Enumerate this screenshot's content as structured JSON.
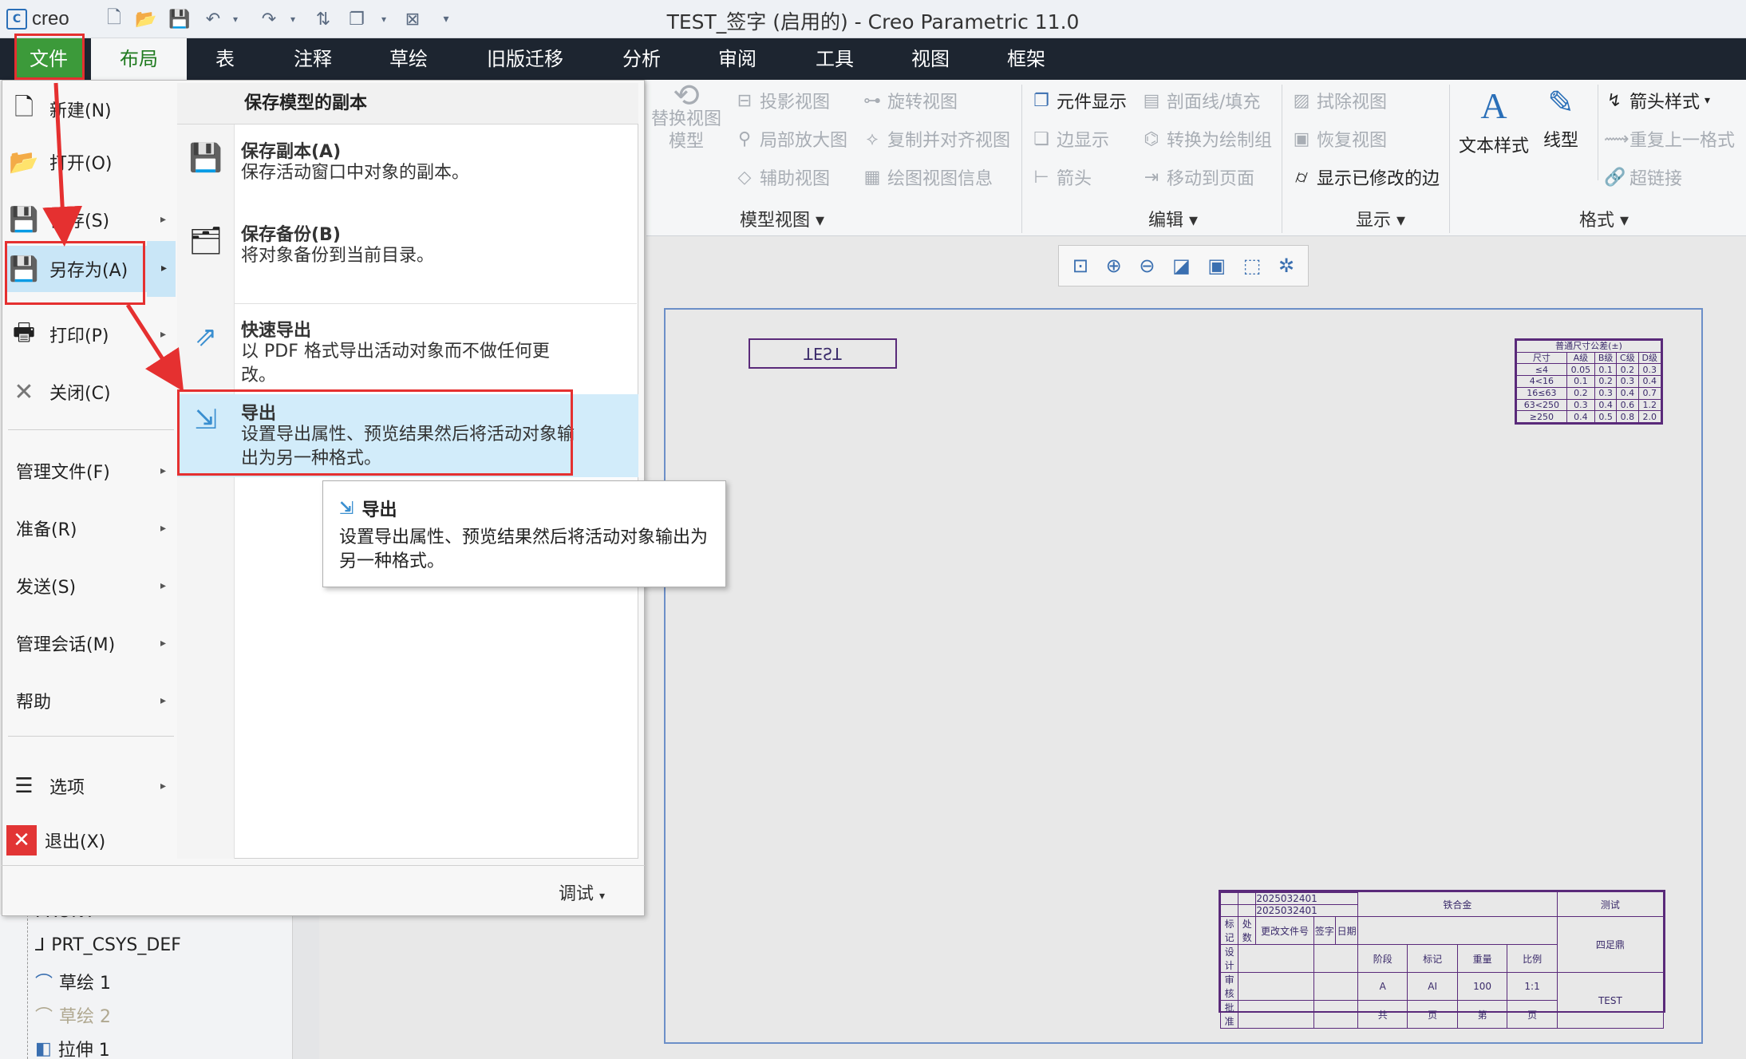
{
  "window": {
    "title": "TEST_签字 (启用的) - Creo Parametric 11.0",
    "logo": "creo"
  },
  "tabs": [
    {
      "label": "文件"
    },
    {
      "label": "布局"
    },
    {
      "label": "表"
    },
    {
      "label": "注释"
    },
    {
      "label": "草绘"
    },
    {
      "label": "旧版迁移"
    },
    {
      "label": "分析"
    },
    {
      "label": "审阅"
    },
    {
      "label": "工具"
    },
    {
      "label": "视图"
    },
    {
      "label": "框架"
    }
  ],
  "ribbon": {
    "model_views": {
      "replace": "替换视图\n模型",
      "projection": "投影视图",
      "detail": "局部放大图",
      "auxiliary": "辅助视图",
      "revolve": "旋转视图",
      "copy_align": "复制并对齐视图",
      "view_info": "绘图视图信息",
      "label": "模型视图"
    },
    "edit": {
      "component_display": "元件显示",
      "hatch": "剖面线/填充",
      "edge_display": "边显示",
      "convert_group": "转换为绘制组",
      "arrow": "箭头",
      "move_page": "移动到页面",
      "label": "编辑"
    },
    "display": {
      "erase": "拭除视图",
      "restore": "恢复视图",
      "show_modified": "显示已修改的边",
      "label": "显示"
    },
    "format": {
      "text_style": "文本样式",
      "line_style": "线型",
      "arrow_style": "箭头样式",
      "repeat": "重复上一格式",
      "hyperlink": "超链接",
      "label": "格式"
    }
  },
  "file_menu": {
    "items": [
      {
        "label": "新建(N)"
      },
      {
        "label": "打开(O)"
      },
      {
        "label": "保存(S)"
      },
      {
        "label": "另存为(A)"
      },
      {
        "label": "打印(P)"
      },
      {
        "label": "关闭(C)"
      }
    ],
    "subitems": [
      {
        "label": "管理文件(F)"
      },
      {
        "label": "准备(R)"
      },
      {
        "label": "发送(S)"
      },
      {
        "label": "管理会话(M)"
      },
      {
        "label": "帮助"
      }
    ],
    "bottom": [
      {
        "label": "选项"
      },
      {
        "label": "退出(X)"
      }
    ],
    "debug": "调试"
  },
  "save_as_panel": {
    "header": "保存模型的副本",
    "items": [
      {
        "title": "保存副本(A)",
        "desc": "保存活动窗口中对象的副本。"
      },
      {
        "title": "保存备份(B)",
        "desc": "将对象备份到当前目录。"
      },
      {
        "title": "快速导出",
        "desc": "以 PDF 格式导出活动对象而不做任何更改。"
      },
      {
        "title": "导出",
        "desc": "设置导出属性、预览结果然后将活动对象输出为另一种格式。"
      }
    ]
  },
  "tooltip": {
    "title": "导出",
    "desc": "设置导出属性、预览结果然后将活动对象输出为另一种格式。"
  },
  "tree": [
    {
      "label": "FRONT"
    },
    {
      "label": "PRT_CSYS_DEF"
    },
    {
      "label": "草绘 1"
    },
    {
      "label": "草绘 2"
    },
    {
      "label": "拉伸 1"
    }
  ],
  "drawing": {
    "test_label": "TEST",
    "tol_table": {
      "title": "普通尺寸公差(±)",
      "header": [
        "尺寸",
        "A级",
        "B级",
        "C级",
        "D级"
      ],
      "rows": [
        [
          "≤4",
          "0.05",
          "0.1",
          "0.2",
          "0.3"
        ],
        [
          "4<16",
          "0.1",
          "0.2",
          "0.3",
          "0.4"
        ],
        [
          "16≤63",
          "0.2",
          "0.3",
          "0.4",
          "0.7"
        ],
        [
          "63<250",
          "0.3",
          "0.4",
          "0.6",
          "1.2"
        ],
        [
          "≥250",
          "0.4",
          "0.5",
          "0.8",
          "2.0"
        ]
      ]
    },
    "title_block": {
      "date1": "2025032401",
      "date2": "2025032401",
      "material": "铁合金",
      "name": "测试",
      "drawing_no": "TEST",
      "company": "四足鼎",
      "stage": "A",
      "mark": "AI",
      "weight": "100",
      "scale": "1:1",
      "h_mark": "标记",
      "h_count": "处数",
      "h_file": "更改文件号",
      "h_sign": "签字",
      "h_date": "日期",
      "h_design": "设计",
      "h_review": "审核",
      "h_approve": "批准",
      "h_stage": "阶段",
      "h_label": "标记",
      "h_weight": "重量",
      "h_ratio": "比例",
      "h_total": "共",
      "h_page": "页",
      "h_no": "第"
    }
  }
}
